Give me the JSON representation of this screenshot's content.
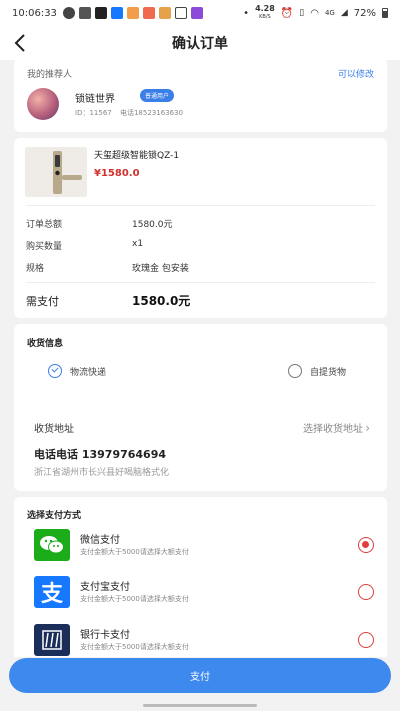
{
  "status_bar": {
    "time": "10:06:33",
    "net_speed": "4.28",
    "net_unit": "KB/S",
    "network_type": "4G",
    "battery": "72%"
  },
  "nav": {
    "title": "确认订单"
  },
  "referrer": {
    "section_title": "我的推荐人",
    "edit_label": "可以修改",
    "name": "锁链世界",
    "badge": "普通用户",
    "id_text": "ID：11567",
    "phone_text": "电话18523163630"
  },
  "product": {
    "name": "天玺超级智能锁QZ-1",
    "price": "¥1580.0"
  },
  "order": {
    "rows": [
      {
        "label": "订单总额",
        "value": "1580.0元"
      },
      {
        "label": "购买数量",
        "value": "x1"
      },
      {
        "label": "规格",
        "value": "玫瑰金 包安装"
      }
    ],
    "pay_label": "需支付",
    "pay_value": "1580.0元"
  },
  "receive": {
    "section_title": "收货信息",
    "option_express": "物流快递",
    "option_pickup": "自提货物",
    "selected": "express",
    "address_label": "收货地址",
    "address_choose": "选择收货地址",
    "phone_line": "电话电话  13979764694",
    "address_line": "浙江省湖州市长兴县好喝脑格式化"
  },
  "payment": {
    "section_title": "选择支付方式",
    "methods": [
      {
        "name": "微信支付",
        "desc": "支付金额大于5000请选择大额支付",
        "icon": "wechat-pay-icon",
        "color": "#1aad19",
        "selected": true
      },
      {
        "name": "支付宝支付",
        "desc": "支付金额大于5000请选择大额支付",
        "icon": "alipay-icon",
        "color": "#1677ff",
        "selected": false
      },
      {
        "name": "银行卡支付",
        "desc": "支付金额大于5000请选择大额支付",
        "icon": "bank-card-icon",
        "color": "#1b2e5a",
        "selected": false
      }
    ]
  },
  "pay_button": {
    "label": "支付"
  },
  "colors": {
    "accent": "#3d89ee",
    "price_red": "#d0312d",
    "radio_red": "#e0403b"
  }
}
